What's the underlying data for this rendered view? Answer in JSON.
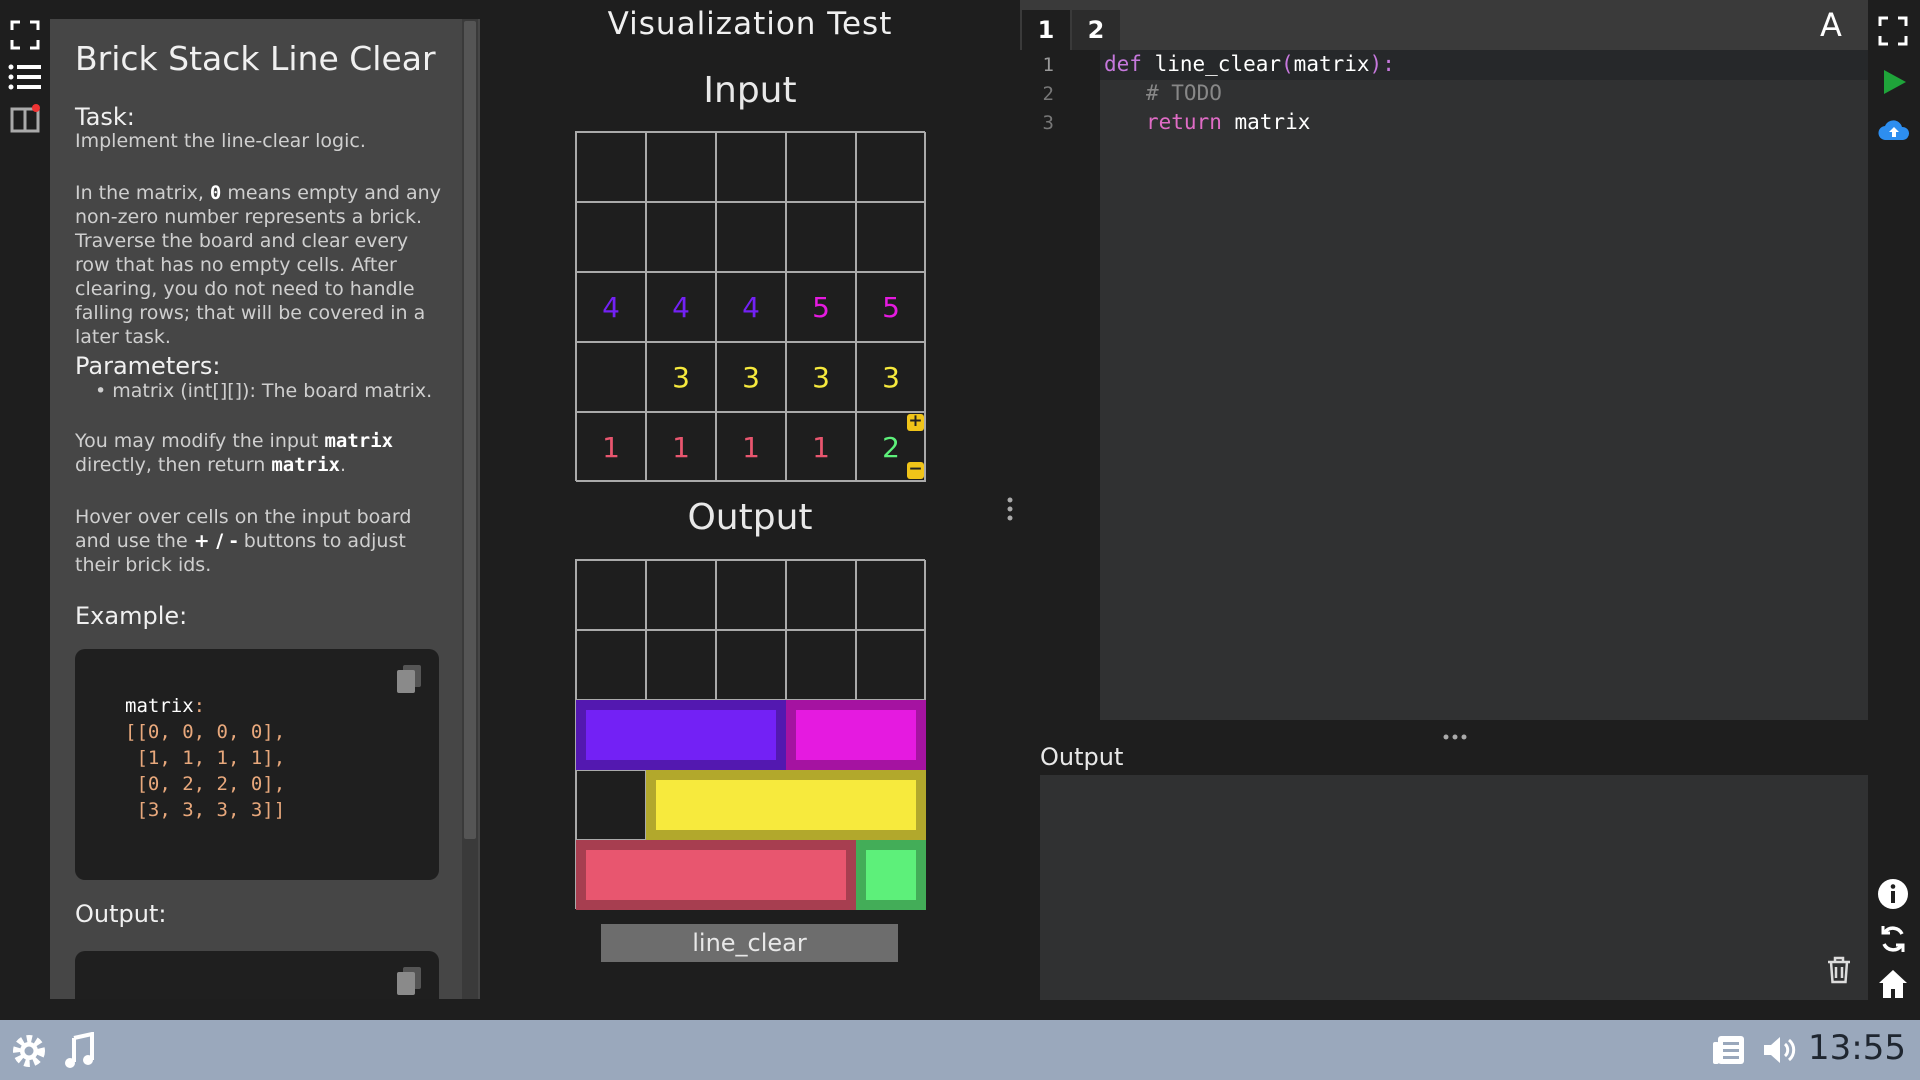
{
  "task": {
    "title": "Brick Stack Line Clear",
    "task_heading": "Task:",
    "task_text": "Implement the line-clear logic.",
    "desc_pre": "In the matrix, ",
    "desc_zero": "0",
    "desc_post": " means empty and any non-zero number represents a brick. Traverse the board and clear every row that has no empty cells. After clearing, you do not need to handle falling rows; that will be covered in a later task.",
    "params_heading": "Parameters:",
    "param_item": "matrix (int[][]): The board matrix.",
    "modify_pre": "You may modify the input ",
    "modify_code1": "matrix",
    "modify_mid": " directly, then return ",
    "modify_code2": "matrix",
    "modify_end": ".",
    "hover_pre": "Hover over cells on the input board and use the ",
    "hover_buttons": "+ / -",
    "hover_post": " buttons to adjust their brick ids.",
    "example_heading": "Example:",
    "example_code": {
      "label": "matrix",
      "colon": ":",
      "lines": [
        "[[0, 0, 0, 0],",
        " [1, 1, 1, 1],",
        " [0, 2, 2, 0],",
        " [3, 3, 3, 3]]"
      ]
    },
    "output_heading": "Output:"
  },
  "viz": {
    "title": "Visualization Test",
    "input_title": "Input",
    "output_title": "Output",
    "input_matrix": [
      [
        0,
        0,
        0,
        0,
        0
      ],
      [
        0,
        0,
        0,
        0,
        0
      ],
      [
        4,
        4,
        4,
        5,
        5
      ],
      [
        0,
        3,
        3,
        3,
        3
      ],
      [
        1,
        1,
        1,
        1,
        2
      ]
    ],
    "colors": {
      "1": "#e8566f",
      "2": "#5df07a",
      "3": "#f7ea3d",
      "4": "#7321f5",
      "5": "#e51ae0"
    },
    "plus": "+",
    "minus": "−",
    "button_label": "line_clear"
  },
  "editor": {
    "tabs": [
      "1",
      "2"
    ],
    "font_icon": "A",
    "line_numbers": [
      "1",
      "2",
      "3"
    ],
    "code": {
      "l1_kw": "def",
      "l1_fn": " line_clear",
      "l1_open": "(",
      "l1_arg": "matrix",
      "l1_close": ")",
      "l1_colon": ":",
      "l2": "# TODO",
      "l3_kw": "return",
      "l3_val": " matrix"
    },
    "output_label": "Output"
  },
  "taskbar": {
    "clock": "13:55"
  }
}
